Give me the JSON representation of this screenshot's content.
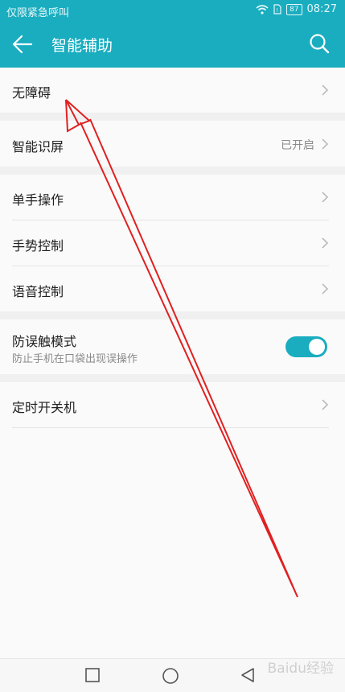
{
  "status_bar": {
    "carrier_text": "仅限紧急呼叫",
    "battery": "87",
    "time": "08:27",
    "icons": [
      "wifi-icon",
      "sim-icon",
      "battery-icon"
    ]
  },
  "app_bar": {
    "title": "智能辅助",
    "back_icon": "arrow-left-icon",
    "search_icon": "search-icon",
    "color": "#1aadc0"
  },
  "settings": {
    "accessibility": {
      "label": "无障碍"
    },
    "smart_screen": {
      "label": "智能识屏",
      "value": "已开启"
    },
    "one_hand": {
      "label": "单手操作"
    },
    "gesture": {
      "label": "手势控制"
    },
    "voice": {
      "label": "语音控制"
    },
    "pocket_mode": {
      "label": "防误触模式",
      "description": "防止手机在口袋出现误操作",
      "enabled": true
    },
    "schedule_power": {
      "label": "定时开关机"
    }
  },
  "nav_bar": {
    "icons": [
      "recent-apps-icon",
      "home-icon",
      "back-icon"
    ]
  },
  "watermark": "Baidu经验",
  "annotation_color": "#e02020"
}
